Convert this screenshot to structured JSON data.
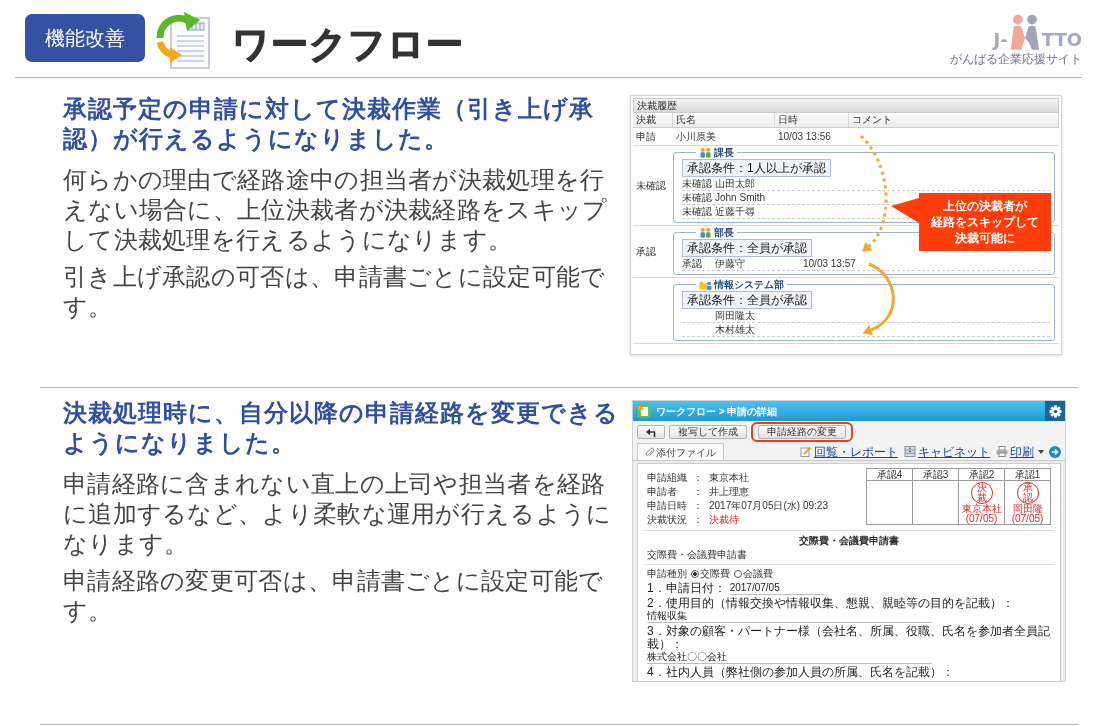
{
  "header": {
    "badge": "機能改善",
    "title": "ワークフロー",
    "logo": {
      "prefix": "J-",
      "suffix": "TTO",
      "tagline": "がんばる企業応援サイト"
    }
  },
  "sections": [
    {
      "kind": "approval_history",
      "heading": "承認予定の申請に対して決裁作業（引き上げ承認）が行えるようになりました。",
      "paragraphs": [
        "何らかの理由で経路途中の担当者が決裁処理を行えない場合に、上位決裁者が決裁経路をスキップして決裁処理を行えるようになります。",
        "引き上げ承認の可否は、申請書ごとに設定可能です。"
      ],
      "screenshot": {
        "panel_title": "決裁履歴",
        "columns": [
          "決裁",
          "氏名",
          "日時",
          "コメント"
        ],
        "request": {
          "status": "申請",
          "name": "小川原美",
          "time": "10/03 13:56"
        },
        "groups": [
          {
            "kind": "position",
            "status": "未確認",
            "legend": "課長",
            "condition": "承認条件：1人以上が承認",
            "approvers": [
              {
                "status": "未確認",
                "name": "山田太郎"
              },
              {
                "status": "未確認",
                "name": "John Smith"
              },
              {
                "status": "未確認",
                "name": "近藤千尋"
              }
            ]
          },
          {
            "kind": "position",
            "status": "承認",
            "legend": "部長",
            "condition": "承認条件：全員が承認",
            "approvers": [
              {
                "status": "承認",
                "name": "伊藤守",
                "time": "10/03 13:57"
              }
            ]
          },
          {
            "kind": "department",
            "legend": "情報システム部",
            "condition": "承認条件：全員が承認",
            "approvers": [
              {
                "name": "岡田隆太"
              },
              {
                "name": "木村雄太"
              }
            ]
          }
        ],
        "callout": [
          "上位の決裁者が",
          "経路をスキップして",
          "決裁可能に"
        ]
      }
    },
    {
      "kind": "request_detail",
      "heading": "決裁処理時に、自分以降の申請経路を変更できるようになりました。",
      "paragraphs": [
        "申請経路に含まれない直上の上司や担当者を経路に追加するなど、より柔軟な運用が行えるようになります。",
        "申請経路の変更可否は、申請書ごとに設定可能です。"
      ],
      "screenshot": {
        "breadcrumb": "ワークフロー > 申請の詳細",
        "toolbar": [
          {
            "kind": "back",
            "highlighted": false
          },
          {
            "kind": "text",
            "label": "複写して作成",
            "highlighted": false
          },
          {
            "kind": "text",
            "label": "申請経路の変更",
            "highlighted": true
          }
        ],
        "tab": "添付ファイル",
        "links": [
          {
            "kind": "report",
            "label": "回覧・レポート"
          },
          {
            "kind": "cabinet",
            "label": "キャビネット"
          },
          {
            "kind": "print",
            "label": "印刷"
          }
        ],
        "info": [
          {
            "kind": "text",
            "label": "申請組織",
            "colon": "：",
            "value": "東京本社"
          },
          {
            "kind": "text",
            "label": "申請者",
            "colon": "：",
            "value": "井上理恵"
          },
          {
            "kind": "text",
            "label": "申請日時",
            "colon": "：",
            "value": "2017年07月05日(水) 09:23"
          },
          {
            "kind": "status",
            "label": "決裁状況",
            "colon": "：",
            "value": "決裁待"
          }
        ],
        "approvals": [
          {
            "header": "承認4"
          },
          {
            "header": "承認3"
          },
          {
            "header": "承認2",
            "stamp": "決裁",
            "stamp_name": "東京本社",
            "stamp_date": "(07/05)"
          },
          {
            "header": "承認1",
            "stamp": "承認",
            "stamp_name": "岡田隆",
            "stamp_date": "(07/05)"
          }
        ],
        "form": {
          "title": "交際費・会議費申請書",
          "subtitle": "交際費・会議費申請書",
          "type_field": {
            "label": "申請種別",
            "options": [
              {
                "label": "交際費",
                "selected": true
              },
              {
                "label": "会議費",
                "selected": false
              }
            ]
          },
          "items": [
            {
              "kind": "inline",
              "label": "1．申請日付：",
              "value": "2017/07/05"
            },
            {
              "kind": "block",
              "label": "2．使用目的（情報交換や情報収集、懇親、親睦等の目的を記載）：",
              "value": "情報収集"
            },
            {
              "kind": "block",
              "label": "3．対象の顧客・パートナー様（会社名、所属、役職、氏名を参加者全員記載）：",
              "value": "株式会社〇〇会社"
            },
            {
              "kind": "block",
              "label": "4．社内人員（弊社側の参加人員の所属、氏名を記載）："
            }
          ]
        }
      }
    }
  ]
}
